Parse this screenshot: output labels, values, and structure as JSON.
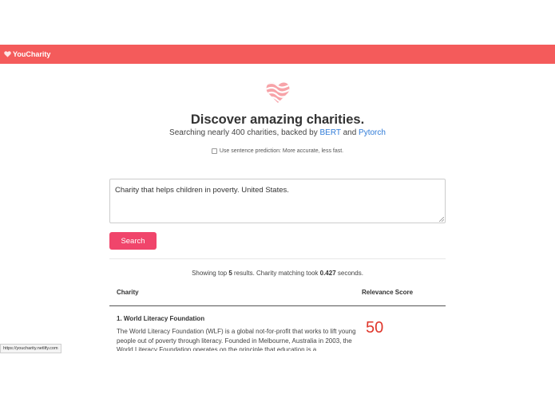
{
  "navbar": {
    "brand": "YouCharity"
  },
  "hero": {
    "title": "Discover amazing charities.",
    "subtitle_prefix": "Searching nearly 400 charities, backed by",
    "link_bert": "BERT",
    "subtitle_and": "and",
    "link_pytorch": "Pytorch",
    "sentence_option": "Use sentence prediction: More accurate, less fast."
  },
  "search": {
    "query": "Charity that helps children in poverty. United States.",
    "button_label": "Search"
  },
  "results": {
    "summary_prefix": "Showing top",
    "count": "5",
    "summary_middle": "results. Charity matching took",
    "time": "0.427",
    "summary_suffix": "seconds.",
    "columns": {
      "charity": "Charity",
      "score": "Relevance Score"
    },
    "rows": [
      {
        "name": "1. World Literacy Foundation",
        "description": "The World Literacy Foundation (WLF) is a global not-for-profit that works to lift young people out of poverty through literacy. Founded in Melbourne, Australia in 2003, the World Literacy Foundation operates on the principle that education is a",
        "score": "50"
      }
    ]
  },
  "status_bar": {
    "url": "https://youcharity.netlify.com"
  },
  "colors": {
    "navbar": "#f45b5b",
    "button": "#f0456b",
    "link": "#2f7bd8",
    "score": "#e0372c"
  }
}
